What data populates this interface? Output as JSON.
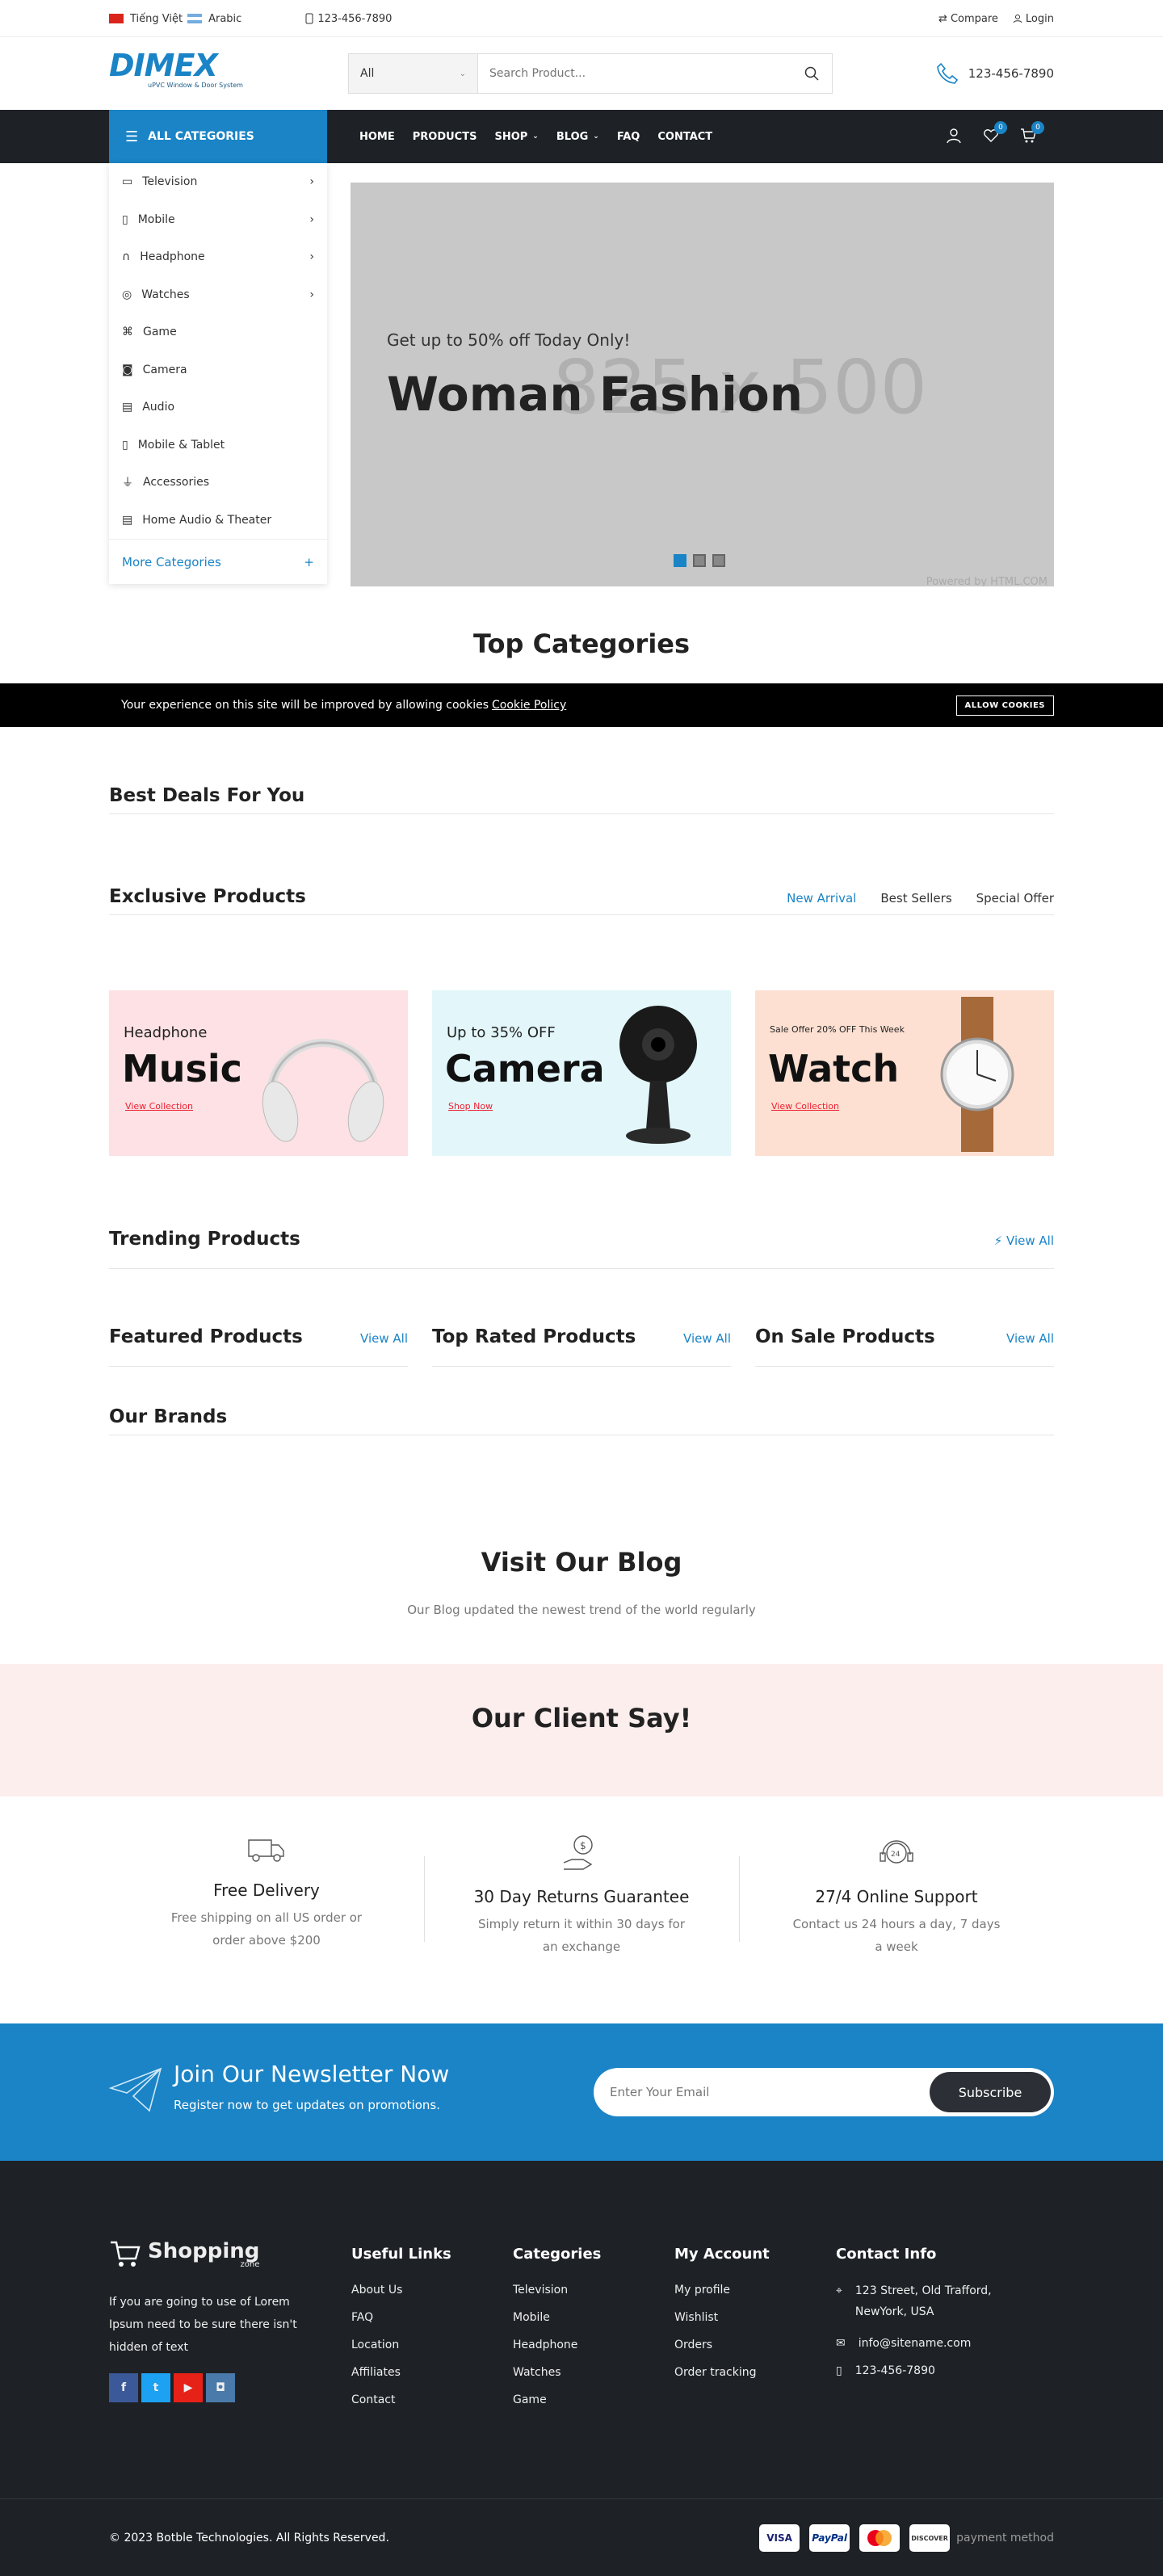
{
  "topbar": {
    "lang1": "Tiếng Việt",
    "lang2": "Arabic",
    "phone": "123-456-7890",
    "compare": "Compare",
    "login": "Login"
  },
  "header": {
    "logo": "DIMEX",
    "logo_sub": "uPVC Window & Door System",
    "search_cat": "All",
    "search_placeholder": "Search Product...",
    "phone": "123-456-7890"
  },
  "nav": {
    "all_categories": "ALL CATEGORIES",
    "menu": [
      "HOME",
      "PRODUCTS",
      "SHOP",
      "BLOG",
      "FAQ",
      "CONTACT"
    ],
    "wishlist_count": "0",
    "cart_count": "0"
  },
  "categories": {
    "items": [
      "Television",
      "Mobile",
      "Headphone",
      "Watches",
      "Game",
      "Camera",
      "Audio",
      "Mobile & Tablet",
      "Accessories",
      "Home Audio & Theater"
    ],
    "more": "More Categories"
  },
  "hero": {
    "placeholder": "825 x 500",
    "subtitle": "Get up to 50% off Today Only!",
    "title": "Woman Fashion",
    "footer": "Powered by HTML.COM"
  },
  "top_categories": {
    "title": "Top Categories"
  },
  "cookie": {
    "text": "Your experience on this site will be improved by allowing cookies",
    "link": "Cookie Policy",
    "button": "ALLOW COOKIES"
  },
  "best_deals": {
    "title": "Best Deals For You"
  },
  "exclusive": {
    "title": "Exclusive Products",
    "tabs": [
      "New Arrival",
      "Best Sellers",
      "Special Offer"
    ]
  },
  "banners": [
    {
      "small": "Headphone",
      "big": "Music",
      "link": "View Collection"
    },
    {
      "small": "Up to 35% OFF",
      "big": "Camera",
      "link": "Shop Now"
    },
    {
      "small": "Sale Offer 20% OFF This Week",
      "big": "Watch",
      "link": "View Collection"
    }
  ],
  "trending": {
    "title": "Trending Products",
    "view_all": "View All"
  },
  "featured": {
    "title": "Featured Products",
    "view_all": "View All"
  },
  "top_rated": {
    "title": "Top Rated Products",
    "view_all": "View All"
  },
  "on_sale": {
    "title": "On Sale Products",
    "view_all": "View All"
  },
  "brands": {
    "title": "Our Brands"
  },
  "blog": {
    "title": "Visit Our Blog",
    "subtitle": "Our Blog updated the newest trend of the world regularly"
  },
  "client": {
    "title": "Our Client Say!"
  },
  "features": [
    {
      "title": "Free Delivery",
      "desc": "Free shipping on all US order or order above $200"
    },
    {
      "title": "30 Day Returns Guarantee",
      "desc": "Simply return it within 30 days for an exchange"
    },
    {
      "title": "27/4 Online Support",
      "desc": "Contact us 24 hours a day, 7 days a week"
    }
  ],
  "newsletter": {
    "title": "Join Our Newsletter Now",
    "subtitle": "Register now to get updates on promotions.",
    "placeholder": "Enter Your Email",
    "button": "Subscribe"
  },
  "footer": {
    "brand": "Shopping",
    "brand_sub": "zone",
    "about": "If you are going to use of Lorem Ipsum need to be sure there isn't hidden of text",
    "useful_title": "Useful Links",
    "useful": [
      "About Us",
      "FAQ",
      "Location",
      "Affiliates",
      "Contact"
    ],
    "cat_title": "Categories",
    "cats": [
      "Television",
      "Mobile",
      "Headphone",
      "Watches",
      "Game"
    ],
    "account_title": "My Account",
    "account": [
      "My profile",
      "Wishlist",
      "Orders",
      "Order tracking"
    ],
    "contact_title": "Contact Info",
    "address": "123 Street, Old Trafford, NewYork, USA",
    "email": "info@sitename.com",
    "phone": "123-456-7890",
    "copyright": "© 2023 Botble Technologies. All Rights Reserved.",
    "payments": [
      "VISA",
      "PayPal",
      "MC",
      "DISCOVER"
    ],
    "payment_alt": "payment method"
  },
  "colors": {
    "accent": "#1a84c6",
    "dark": "#1e2226"
  }
}
